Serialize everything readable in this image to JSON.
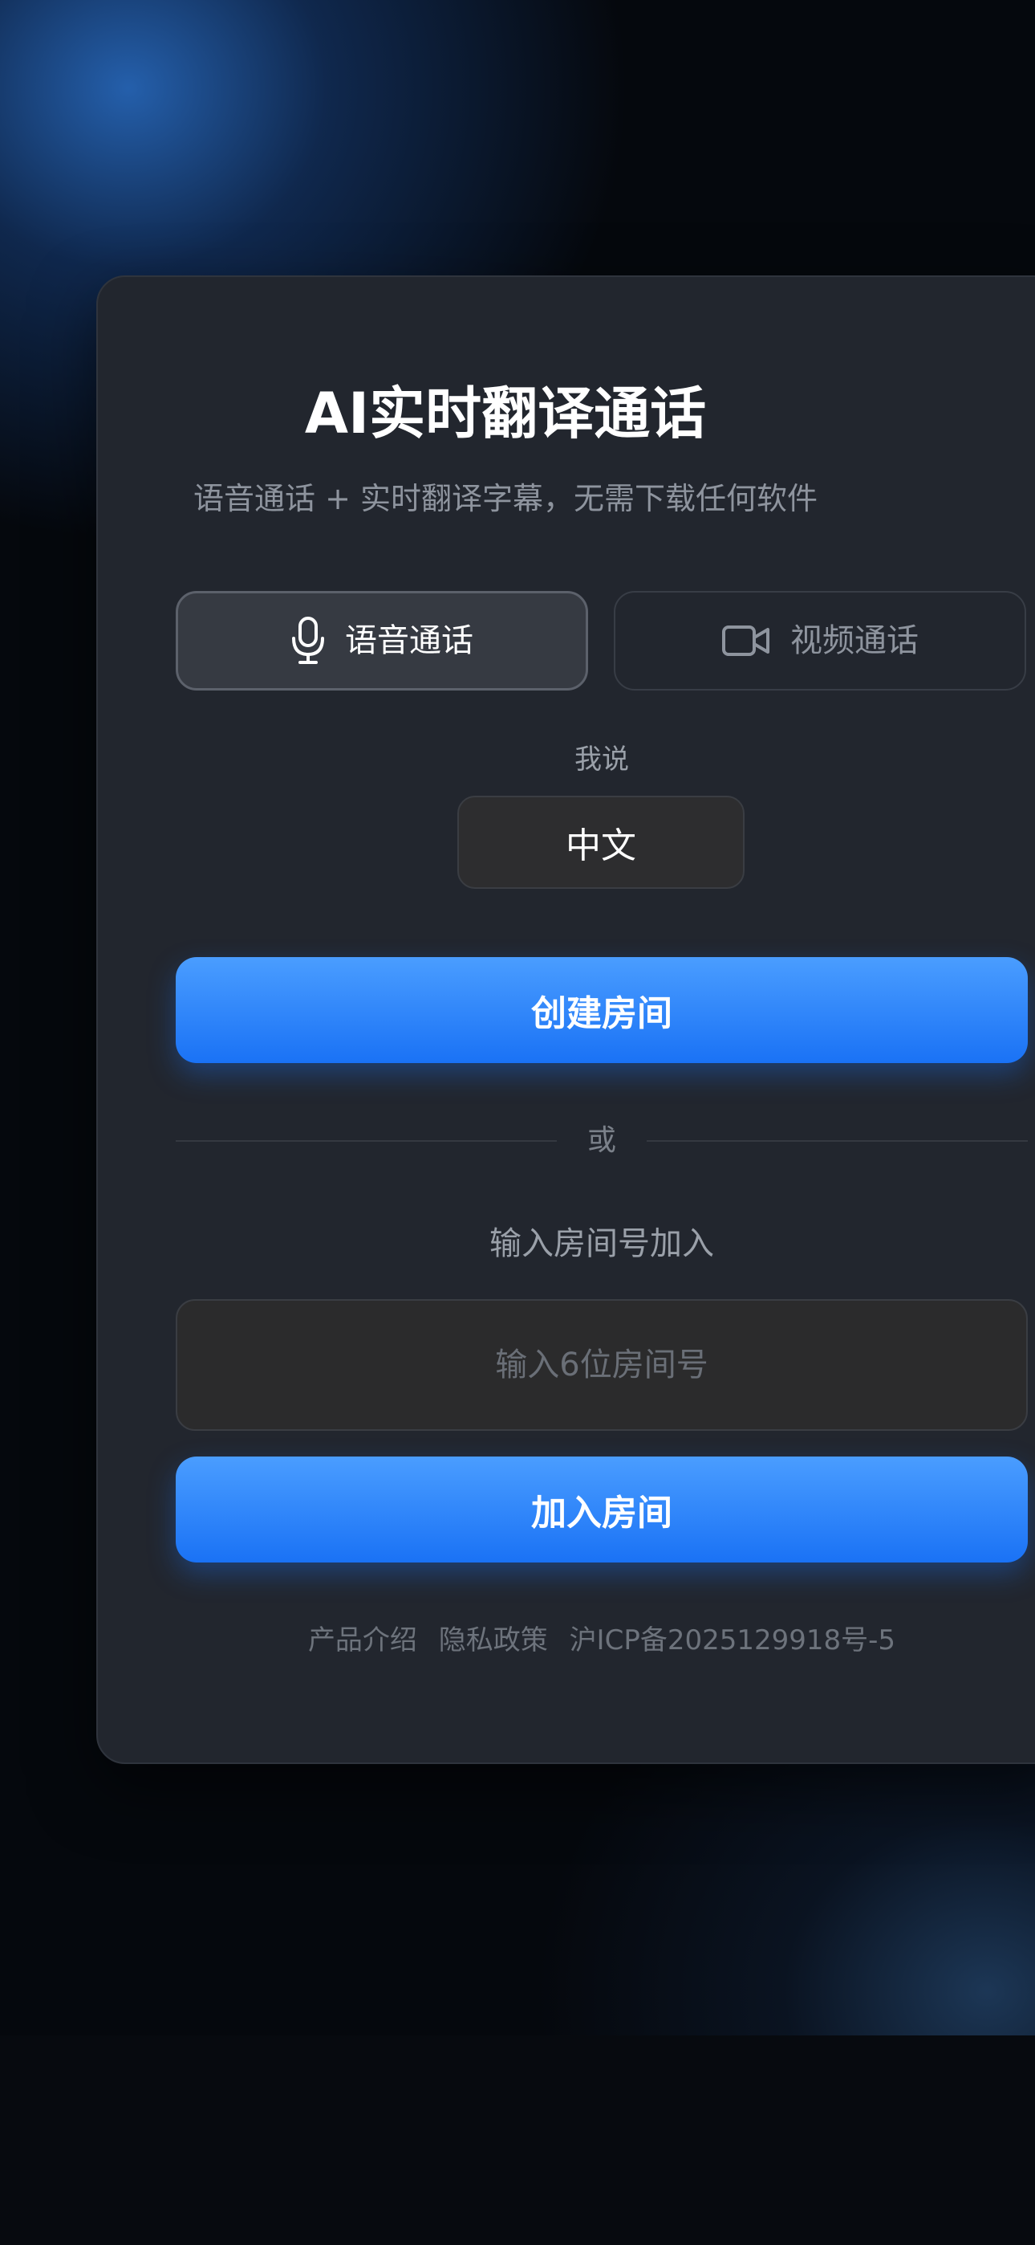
{
  "header": {
    "title": "AI实时翻译通话",
    "subtitle": "语音通话 + 实时翻译字幕，无需下载任何软件"
  },
  "call_modes": [
    {
      "label": "语音通话",
      "icon": "microphone-icon",
      "selected": true
    },
    {
      "label": "视频通话",
      "icon": "video-camera-icon",
      "selected": false
    }
  ],
  "language": {
    "label": "我说",
    "selected_value": "中文"
  },
  "actions": {
    "create_room_label": "创建房间",
    "divider_text": "或",
    "join_section_label": "输入房间号加入",
    "room_input_value": "",
    "room_input_placeholder": "输入6位房间号",
    "join_room_label": "加入房间"
  },
  "footer": {
    "product_intro": "产品介绍",
    "privacy_policy": "隐私政策",
    "icp": "沪ICP备2025129918号-5"
  },
  "colors": {
    "accent": "#1a72f5",
    "accent_light": "#4a9dff",
    "card_background": "#22262e",
    "page_background": "#05080d"
  }
}
